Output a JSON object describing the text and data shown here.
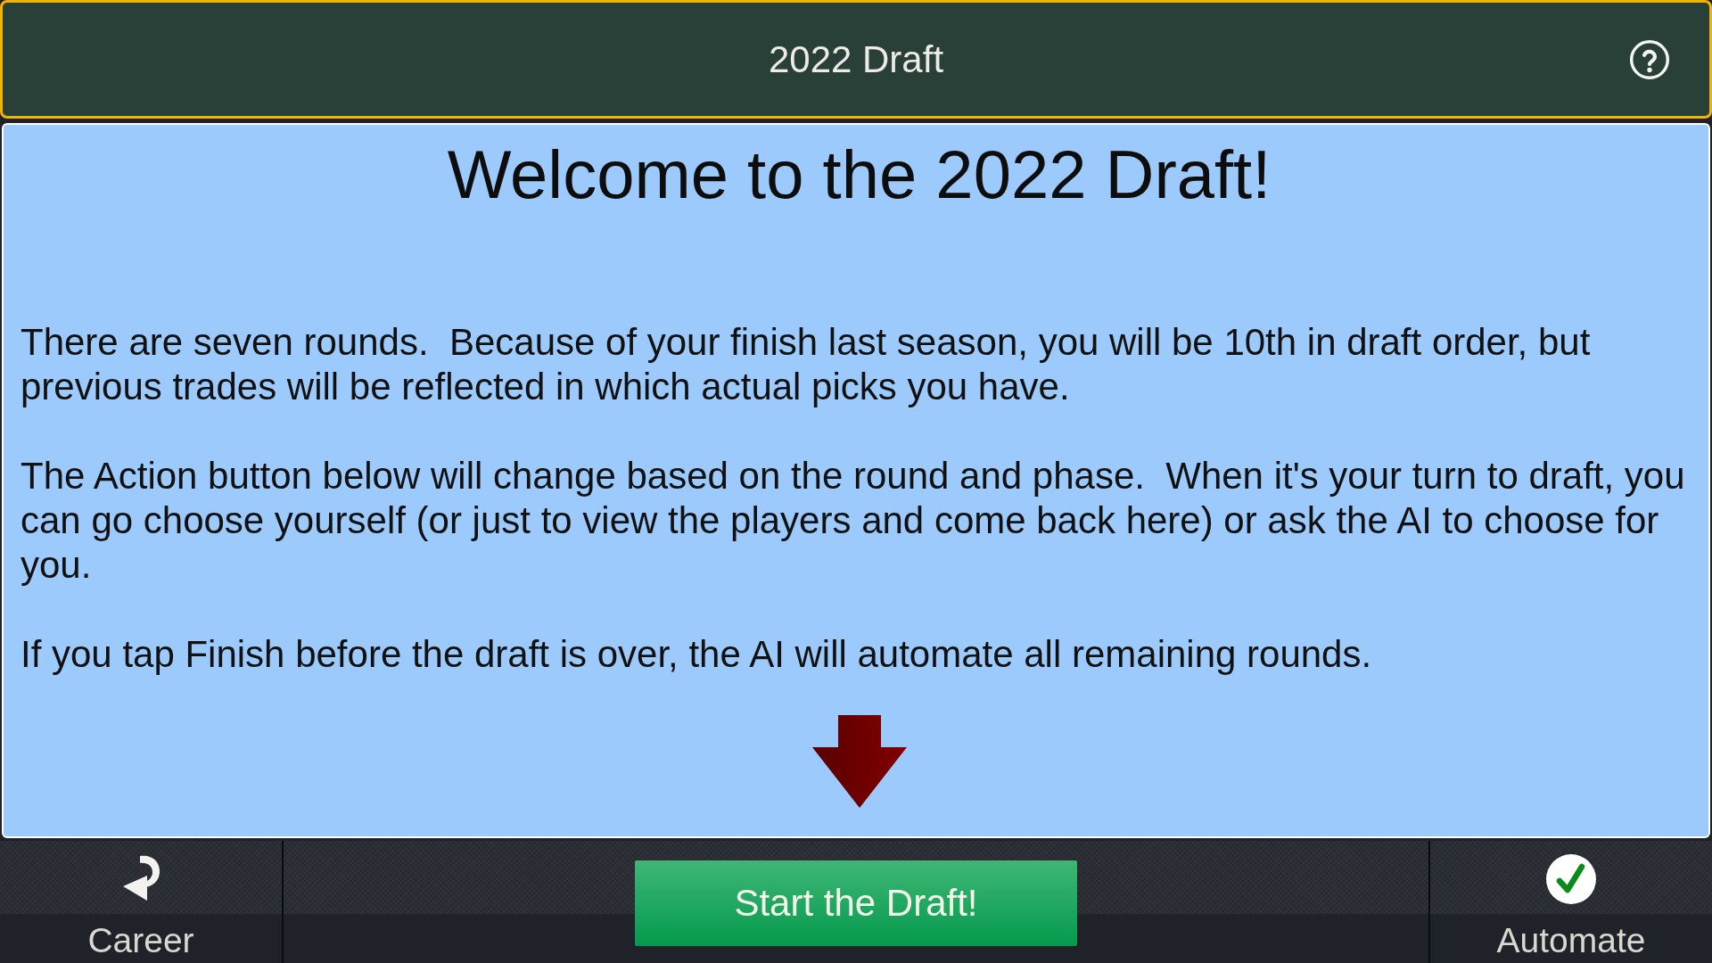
{
  "header": {
    "title": "2022 Draft"
  },
  "welcome": {
    "heading": "Welcome to the 2022 Draft!",
    "paragraphs": [
      "There are seven rounds.  Because of your finish last season, you will be 10th in draft order, but previous trades will be reflected in which actual picks you have.",
      "The Action button below will change based on the round and phase.  When it's your turn to draft, you can go choose yourself (or just to view the players and come back here) or ask the AI to choose for you.",
      "If you tap Finish before the draft is over, the AI will automate all remaining rounds."
    ]
  },
  "bottom_bar": {
    "buttons": [
      {
        "kind": "back",
        "label": "Career"
      },
      {
        "kind": "action",
        "label": "Start the Draft!"
      },
      {
        "kind": "confirm",
        "label": "Automate"
      }
    ]
  }
}
